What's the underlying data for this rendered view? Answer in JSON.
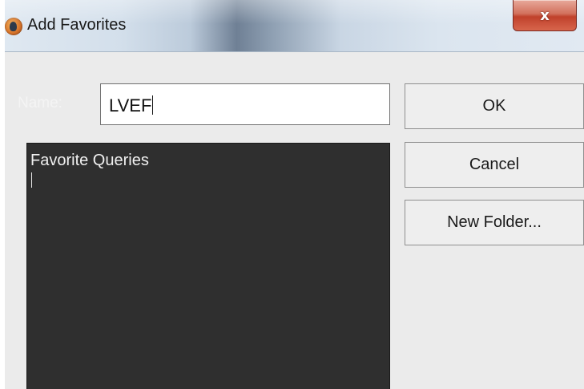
{
  "window": {
    "title": "Add Favorites",
    "close_glyph": "x"
  },
  "form": {
    "name_label": "Name:",
    "name_value": "LVEF"
  },
  "buttons": {
    "ok": "OK",
    "cancel": "Cancel",
    "new_folder": "New Folder..."
  },
  "tree": {
    "root_label": "Favorite Queries"
  },
  "icons": {
    "app": "app-icon",
    "close": "close-icon"
  },
  "colors": {
    "tree_background": "#2f2f2f",
    "dialog_background": "#ebebeb",
    "close_button": "#c9503a"
  }
}
